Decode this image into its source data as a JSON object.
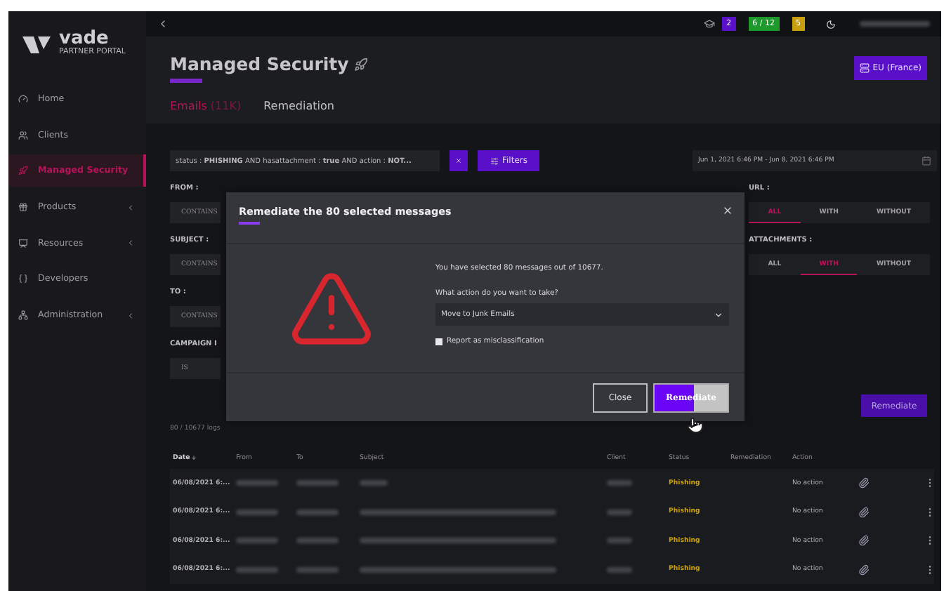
{
  "topbar": {
    "badges": [
      {
        "text": "2",
        "color": "#5a10c8"
      },
      {
        "text": "6 / 12",
        "color": "#1e9a2c"
      },
      {
        "text": "5",
        "color": "#c9a00c"
      }
    ]
  },
  "sidebar": {
    "logo": {
      "name": "vade",
      "tagline": "PARTNER PORTAL"
    },
    "items": [
      {
        "label": "Home",
        "selected": false,
        "expandable": false
      },
      {
        "label": "Clients",
        "selected": false,
        "expandable": false
      },
      {
        "label": "Managed Security",
        "selected": true,
        "expandable": false
      },
      {
        "label": "Products",
        "selected": false,
        "expandable": true
      },
      {
        "label": "Resources",
        "selected": false,
        "expandable": true
      },
      {
        "label": "Developers",
        "selected": false,
        "expandable": false
      },
      {
        "label": "Administration",
        "selected": false,
        "expandable": true
      }
    ]
  },
  "header": {
    "title": "Managed Security",
    "region_button": "EU (France)",
    "tabs": [
      {
        "label": "Emails",
        "count": "(11K)",
        "selected": true
      },
      {
        "label": "Remediation",
        "selected": false
      }
    ]
  },
  "filter_bar": {
    "query": "status : **PHISHING** AND hasattachment : **true** AND action : **NOT...**",
    "filters_button": "Filters",
    "date_range": "Jun 1, 2021 6:46 PM - Jun 8, 2021 6:46 PM"
  },
  "filters": {
    "fields": [
      {
        "label": "FROM :",
        "operator": "CONTAINS"
      },
      {
        "label": "SUBJECT :",
        "operator": "CONTAINS"
      },
      {
        "label": "TO :",
        "operator": "CONTAINS"
      },
      {
        "label": "CAMPAIGN I",
        "operator": "IS"
      }
    ],
    "toggles": [
      {
        "label": "URL :",
        "options": [
          {
            "label": "ALL",
            "selected": true
          },
          {
            "label": "WITH",
            "selected": false
          },
          {
            "label": "WITHOUT",
            "selected": false
          }
        ]
      },
      {
        "label": "ATTACHMENTS :",
        "options": [
          {
            "label": "ALL",
            "selected": false
          },
          {
            "label": "WITH",
            "selected": true
          },
          {
            "label": "WITHOUT",
            "selected": false
          }
        ]
      }
    ]
  },
  "remediate_button": "Remediate",
  "table": {
    "count": "80 / 10677 logs",
    "columns": [
      "Date",
      "From",
      "To",
      "Subject",
      "Client",
      "Status",
      "Remediation",
      "Action"
    ],
    "rows": [
      {
        "date": "06/08/2021 6:...",
        "status": "Phishing",
        "action": "No action"
      },
      {
        "date": "06/08/2021 6:...",
        "status": "Phishing",
        "action": "No action"
      },
      {
        "date": "06/08/2021 6:...",
        "status": "Phishing",
        "action": "No action"
      },
      {
        "date": "06/08/2021 6:...",
        "status": "Phishing",
        "action": "No action"
      }
    ]
  },
  "modal": {
    "title": "Remediate the 80 selected messages",
    "message": "You have selected 80 messages out of 10677.",
    "question": "What action do you want to take?",
    "selected_action": "Move to Junk Emails",
    "checkbox": {
      "label": "Report as misclassification",
      "checked": false
    },
    "buttons": [
      {
        "label": "Close",
        "kind": "secondary"
      },
      {
        "label": "Remediate",
        "kind": "primary"
      }
    ]
  }
}
